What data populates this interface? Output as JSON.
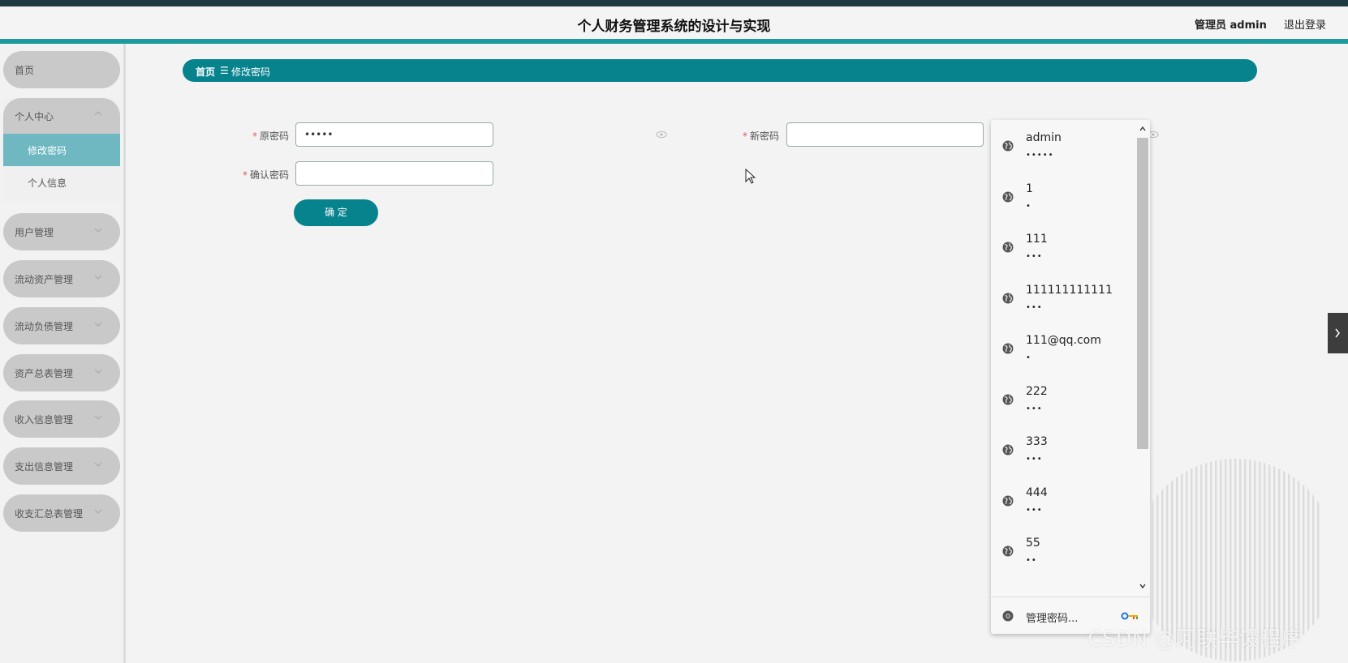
{
  "header": {
    "title": "个人财务管理系统的设计与实现",
    "user": "管理员 admin",
    "logout": "退出登录"
  },
  "sidebar": {
    "home": "首页",
    "personal_center": {
      "label": "个人中心",
      "items": [
        "修改密码",
        "个人信息"
      ]
    },
    "items": [
      "用户管理",
      "流动资产管理",
      "流动负债管理",
      "资产总表管理",
      "收入信息管理",
      "支出信息管理",
      "收支汇总表管理"
    ]
  },
  "breadcrumb": {
    "home": "首页",
    "separator": "☰",
    "current": "修改密码"
  },
  "form": {
    "old_password_label": "原密码",
    "old_password_value": "•••••",
    "new_password_label": "新密码",
    "new_password_value": "",
    "confirm_password_label": "确认密码",
    "confirm_password_value": "",
    "required_mark": "*",
    "submit": "确 定"
  },
  "autofill": {
    "entries": [
      {
        "user": "admin",
        "password": "•••••"
      },
      {
        "user": "1",
        "password": "•"
      },
      {
        "user": "111",
        "password": "•••"
      },
      {
        "user": "111111111111",
        "password": "•••"
      },
      {
        "user": "111@qq.com",
        "password": "•"
      },
      {
        "user": "222",
        "password": "•••"
      },
      {
        "user": "333",
        "password": "•••"
      },
      {
        "user": "444",
        "password": "•••"
      },
      {
        "user": "55",
        "password": "••"
      }
    ],
    "manage": "管理密码..."
  },
  "watermark": "CSDN @阿联毕设程序",
  "colors": {
    "primary": "#07838e",
    "header_border": "#1c9a9e",
    "sidebar_active": "#6fb8c1",
    "menu_bg": "#c9c9c9"
  }
}
